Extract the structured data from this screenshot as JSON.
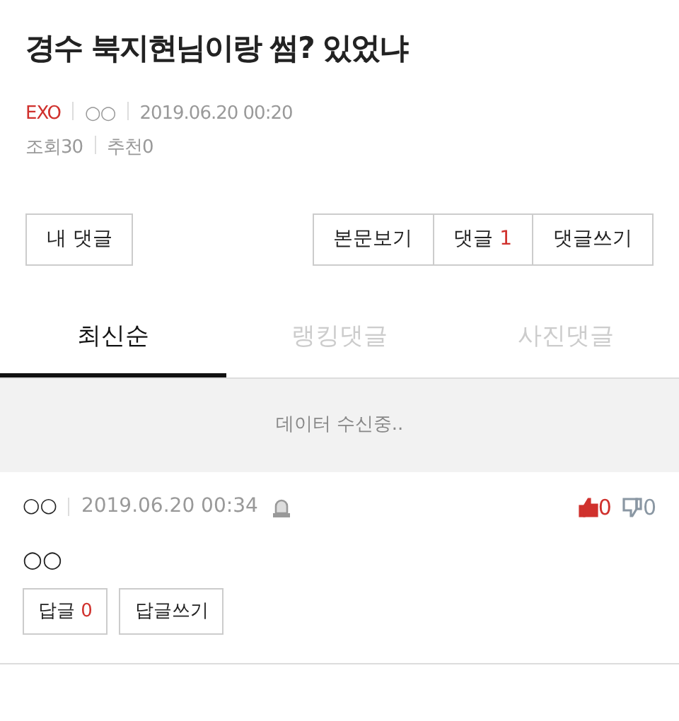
{
  "post": {
    "title": "경수 북지현님이랑 썸? 있었냐",
    "category": "EXO",
    "author": "○○",
    "date": "2019.06.20 00:20",
    "views_label": "조회",
    "views": "30",
    "recommend_label": "추천",
    "recommend": "0"
  },
  "left_buttons": [
    {
      "label": "내 댓글"
    }
  ],
  "right_buttons": [
    {
      "label": "본문보기"
    },
    {
      "label": "댓글",
      "count": "1"
    },
    {
      "label": "댓글쓰기"
    }
  ],
  "tabs": [
    {
      "label": "최신순",
      "selected": true
    },
    {
      "label": "랭킹댓글",
      "selected": false
    },
    {
      "label": "사진댓글",
      "selected": false
    }
  ],
  "loading": "데이터 수신중..",
  "comments": [
    {
      "author": "○○",
      "date": "2019.06.20 00:34",
      "likes": "0",
      "dislikes": "0",
      "text": "○○",
      "reply_label": "답글",
      "reply_count": "0",
      "write_reply": "답글쓰기"
    }
  ]
}
